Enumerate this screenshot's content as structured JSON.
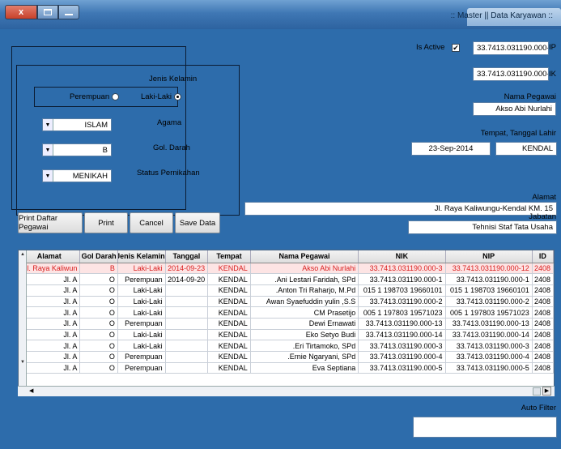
{
  "window": {
    "title": ":: Master || Data Karyawan ::",
    "close_label": "x"
  },
  "form": {
    "nip_label": "NIP",
    "nip_value": "33.7413.031190.000-12",
    "is_active_label": "Is Active",
    "is_active_checked": "✔",
    "nik_label": "NIK",
    "nik_value": "33.7413.031190.000-3",
    "nama_label": "Nama Pegawai",
    "nama_value": "Akso Abi Nurlahi",
    "ttl_label": "Tempat, Tanggal Lahir",
    "tempat_value": "KENDAL",
    "tanggal_value": "23-Sep-2014",
    "alamat_label": "Alamat",
    "alamat_value": "Jl. Raya Kaliwungu-Kendal KM. 15",
    "jabatan_label": "Jabatan",
    "jabatan_value": "Tehnisi Staf Tata Usaha",
    "jenis_kelamin_label": "Jenis Kelamin",
    "laki_label": "Laki-Laki",
    "perempuan_label": "Perempuan",
    "agama_label": "Agama",
    "agama_value": "ISLAM",
    "gol_darah_label": "Gol. Darah",
    "gol_darah_value": "B",
    "status_label": "Status Pernikahan",
    "status_value": "MENIKAH",
    "auto_filter_label": "Auto Filter",
    "auto_filter_value": ""
  },
  "buttons": {
    "save": "Save Data",
    "cancel": "Cancel",
    "print": "Print",
    "print_all": "Print Daftar Pegawai"
  },
  "table": {
    "headers": [
      "ID",
      "NIP",
      "NIK",
      "Nama Pegawai",
      "Tempat",
      "Tanggal",
      "Jenis Kelamin",
      "Gol Darah",
      "Alamat"
    ],
    "rows": [
      [
        "2408",
        "33.7413.031190.000-12",
        "33.7413.031190.000-3",
        "Akso Abi Nurlahi",
        "KENDAL",
        "2014-09-23",
        "Laki-Laki",
        "B",
        "Jl. Raya Kaliwun"
      ],
      [
        "2408",
        "33.7413.031190.000-1",
        "33.7413.031190.000-1",
        "Ani Lestari Faridah, SPd.",
        "KENDAL",
        "2014-09-20",
        "Perempuan",
        "O",
        "Jl. A"
      ],
      [
        "2408",
        "19660101 198703 1 015",
        "19660101 198703 1 015",
        "Anton Tri Raharjo, M.Pd.",
        "KENDAL",
        "",
        "Laki-Laki",
        "O",
        "Jl. A"
      ],
      [
        "2408",
        "33.7413.031190.000-2",
        "33.7413.031190.000-2",
        "Awan Syaefuddin yulin ,S.S",
        "KENDAL",
        "",
        "Laki-Laki",
        "O",
        "Jl. A"
      ],
      [
        "2408",
        "19571023 197803 1 005",
        "19571023 197803 1 005",
        "CM Prasetijo",
        "KENDAL",
        "",
        "Laki-Laki",
        "O",
        "Jl. A"
      ],
      [
        "2408",
        "33.7413.031190.000-13",
        "33.7413.031190.000-13",
        "Dewi Ernawati",
        "KENDAL",
        "",
        "Perempuan",
        "O",
        "Jl. A"
      ],
      [
        "2408",
        "33.7413.031190.000-14",
        "33.7413.031190.000-14",
        "Eko Setyo Budi",
        "KENDAL",
        "",
        "Laki-Laki",
        "O",
        "Jl. A"
      ],
      [
        "2408",
        "33.7413.031190.000-3",
        "33.7413.031190.000-3",
        "Eri Tirtamoko, SPd.",
        "KENDAL",
        "",
        "Laki-Laki",
        "O",
        "Jl. A"
      ],
      [
        "2408",
        "33.7413.031190.000-4",
        "33.7413.031190.000-4",
        "Ernie Ngaryani, SPd.",
        "KENDAL",
        "",
        "Perempuan",
        "O",
        "Jl. A"
      ],
      [
        "2408",
        "33.7413.031190.000-5",
        "33.7413.031190.000-5",
        "Eva Septiana",
        "KENDAL",
        "",
        "Perempuan",
        "O",
        "Jl. A"
      ]
    ]
  }
}
